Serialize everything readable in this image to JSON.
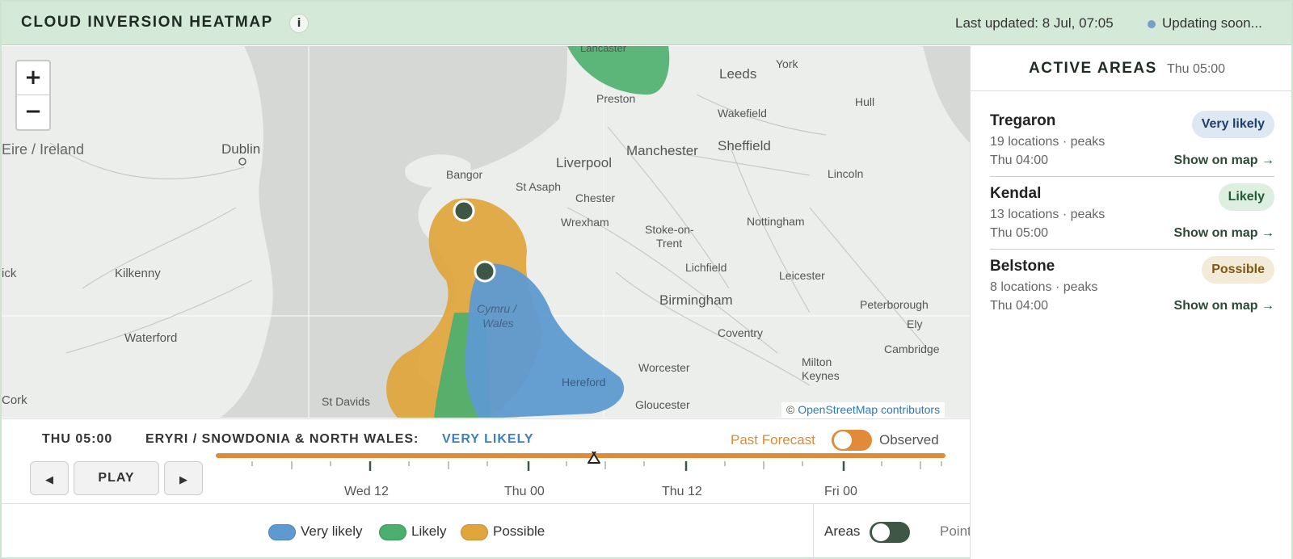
{
  "header": {
    "title": "CLOUD INVERSION HEATMAP",
    "info_glyph": "i",
    "last_updated": "Last updated: 8 Jul, 07:05",
    "update_status": "Updating soon..."
  },
  "map": {
    "zoom_in": "+",
    "zoom_out": "−",
    "attribution_prefix": "©",
    "attribution_link": "OpenStreetMap contributors",
    "place_labels": [
      "Eire / Ireland",
      "Dublin",
      "Kilkenny",
      "Waterford",
      "ick",
      "Cork",
      "Bangor",
      "St Asaph",
      "Chester",
      "Wrexham",
      "Liverpool",
      "Manchester",
      "Sheffield",
      "Leeds",
      "York",
      "Wakefield",
      "Preston",
      "Lancaster",
      "Hull",
      "Lincoln",
      "Nottingham",
      "Stoke-on-",
      "Trent",
      "Lichfield",
      "Leicester",
      "Birmingham",
      "Peterborough",
      "Coventry",
      "Ely",
      "Cambridge",
      "Milton",
      "Keynes",
      "Worcester",
      "Hereford",
      "Gloucester",
      "St Davids",
      "Cymru /",
      "Wales"
    ]
  },
  "controls": {
    "current_time": "THU 05:00",
    "region": "ERYRI / SNOWDONIA & NORTH WALES:",
    "region_status": "VERY LIKELY",
    "past_forecast_label": "Past Forecast",
    "observed_label": "Observed",
    "prev_glyph": "◀",
    "play_label": "PLAY",
    "next_glyph": "▶",
    "timeline_labels": [
      "Wed 12",
      "Thu 00",
      "Thu 12",
      "Fri 00"
    ]
  },
  "legend": {
    "very_likely": "Very likely",
    "likely": "Likely",
    "possible": "Possible",
    "areas_label": "Areas",
    "points_label": "Points"
  },
  "colors": {
    "very_likely": "#5e9ad1",
    "likely": "#4caf6e",
    "possible": "#e0a53c",
    "accent_dark": "#3d5646",
    "forecast": "#e08a3a"
  },
  "panel": {
    "title": "ACTIVE AREAS",
    "time": "Thu 05:00",
    "show_label": "Show on map →",
    "areas": [
      {
        "name": "Tregaron",
        "meta": "19 locations · peaks",
        "time": "Thu 04:00",
        "badge": "Very likely"
      },
      {
        "name": "Kendal",
        "meta": "13 locations · peaks",
        "time": "Thu 05:00",
        "badge": "Likely"
      },
      {
        "name": "Belstone",
        "meta": "8 locations · peaks",
        "time": "Thu 04:00",
        "badge": "Possible"
      }
    ]
  }
}
